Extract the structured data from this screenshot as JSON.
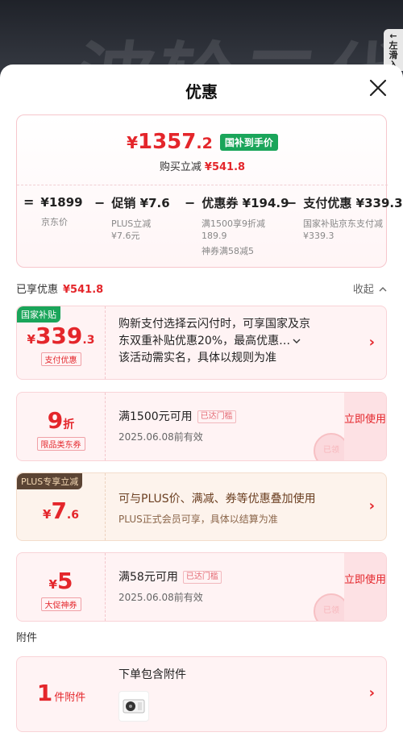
{
  "background": {
    "watermark": "波轮二代",
    "side_tab": "← 左 滑 入"
  },
  "sheet": {
    "title": "优惠",
    "close_icon": "close-icon"
  },
  "summary": {
    "price_symbol": "¥",
    "price_int": "1357",
    "price_dec": ".2",
    "price_badge": "国补到手价",
    "reduce_label": "购买立减",
    "reduce_amount": "¥541.8",
    "calc": [
      {
        "op": "=",
        "main": "¥1899",
        "sub1": "京东价",
        "sub2": "",
        "sub3": ""
      },
      {
        "op": "−",
        "main": "促销 ¥7.6",
        "sub1": "PLUS立减",
        "sub2": "¥7.6元",
        "sub3": ""
      },
      {
        "op": "−",
        "main": "优惠券 ¥194.9",
        "sub1": "满1500享9折减",
        "sub2": "189.9",
        "sub3": "神券满58减5"
      },
      {
        "op": "−",
        "main": "支付优惠 ¥339.3",
        "sub1": "国家补贴京东支付减",
        "sub2": "¥339.3",
        "sub3": ""
      }
    ]
  },
  "enjoyed": {
    "label": "已享优惠",
    "amount": "¥541.8",
    "collapse_label": "收起"
  },
  "cards": [
    {
      "tag": "国家补贴",
      "value_symbol": "¥",
      "value_int": "339",
      "value_dec": ".3",
      "value_label": "支付优惠",
      "line1": "购新支付选择云闪付时，可享国家及京",
      "line2": "东双重补贴优惠20%，最高优惠…",
      "line3": "该活动需实名，具体以规则为准"
    },
    {
      "value_int": "9",
      "value_unit": "折",
      "value_label": "限品类东券",
      "line1": "满1500元可用",
      "badge": "已达门槛",
      "date": "2025.06.08前有效",
      "button": "立即使用",
      "stamp": "已领"
    },
    {
      "tag": "PLUS专享立减",
      "value_symbol": "¥",
      "value_int": "7",
      "value_dec": ".6",
      "line1": "可与PLUS价、满减、券等优惠叠加使用",
      "line2": "PLUS正式会员可享，具体以结算为准"
    },
    {
      "value_symbol": "¥",
      "value_int": "5",
      "value_label": "大促神券",
      "line1": "满58元可用",
      "badge": "已达门槛",
      "date": "2025.06.08前有效",
      "button": "立即使用",
      "stamp": "已领"
    }
  ],
  "accessory": {
    "section_label": "附件",
    "count": "1",
    "count_unit": "件附件",
    "line1": "下单包含附件"
  },
  "colors": {
    "accent": "#e4262b",
    "subsidy_green": "#1aa55a",
    "card_bg": "#fff3f4"
  }
}
